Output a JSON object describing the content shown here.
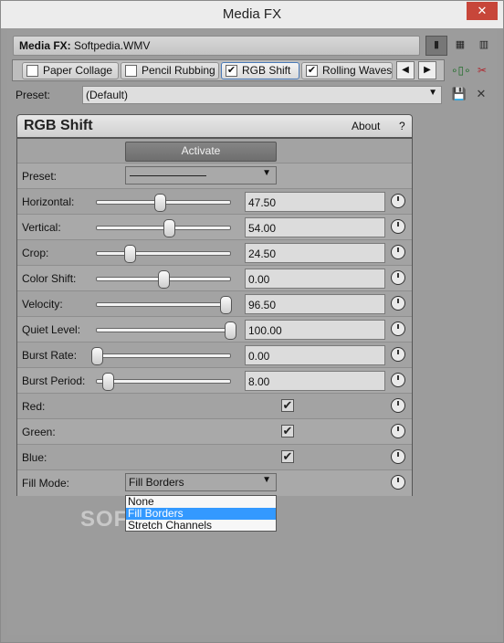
{
  "window": {
    "title": "Media FX",
    "close_glyph": "✕"
  },
  "header": {
    "label": "Media FX:",
    "value": "Softpedia.WMV"
  },
  "view_buttons": [
    {
      "name": "view-list-icon",
      "glyph": "▮"
    },
    {
      "name": "view-grid-icon",
      "glyph": "▦"
    },
    {
      "name": "view-compact-icon",
      "glyph": "▥"
    }
  ],
  "tabs": [
    {
      "label": "Paper Collage",
      "checked": false,
      "active": false
    },
    {
      "label": "Pencil Rubbing",
      "checked": false,
      "active": false
    },
    {
      "label": "RGB Shift",
      "checked": true,
      "active": true
    },
    {
      "label": "Rolling Waves",
      "checked": true,
      "active": false
    }
  ],
  "tab_nav": {
    "prev": "◀",
    "next": "▶"
  },
  "side_icons": {
    "chain": "∘▯∘",
    "remove": "✂"
  },
  "preset": {
    "label": "Preset:",
    "value": "(Default)",
    "save_glyph": "💾",
    "delete_glyph": "✕"
  },
  "plugin": {
    "name": "RGB Shift",
    "about": "About",
    "help": "?"
  },
  "activate_label": "Activate",
  "params": {
    "preset_label": "Preset:",
    "sliders": [
      {
        "label": "Horizontal:",
        "value": "47.50",
        "fraction": 0.475
      },
      {
        "label": "Vertical:",
        "value": "54.00",
        "fraction": 0.54
      },
      {
        "label": "Crop:",
        "value": "24.50",
        "fraction": 0.245
      },
      {
        "label": "Color Shift:",
        "value": "0.00",
        "fraction": 0.5
      },
      {
        "label": "Velocity:",
        "value": "96.50",
        "fraction": 0.965
      },
      {
        "label": "Quiet Level:",
        "value": "100.00",
        "fraction": 1.0
      },
      {
        "label": "Burst Rate:",
        "value": "0.00",
        "fraction": 0.0
      },
      {
        "label": "Burst Period:",
        "value": "8.00",
        "fraction": 0.08
      }
    ],
    "checks": [
      {
        "label": "Red:",
        "checked": true
      },
      {
        "label": "Green:",
        "checked": true
      },
      {
        "label": "Blue:",
        "checked": true
      }
    ],
    "fill_mode": {
      "label": "Fill Mode:",
      "value": "Fill Borders",
      "options": [
        "None",
        "Fill Borders",
        "Stretch Channels"
      ],
      "selected": 1
    }
  },
  "watermark": "SOFTPEDIA"
}
